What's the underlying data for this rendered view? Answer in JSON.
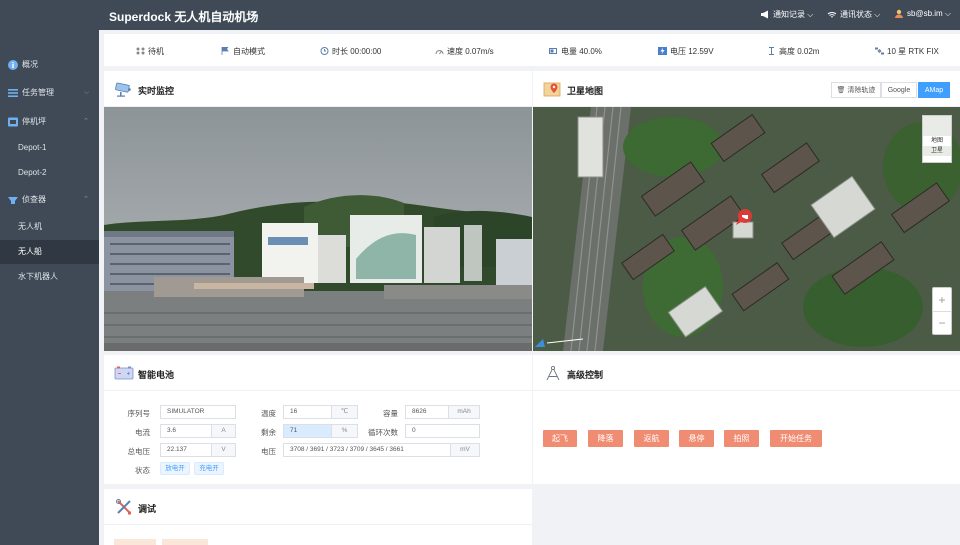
{
  "header": {
    "title": "Superdock 无人机自动机场",
    "notifications": "通知记录",
    "comm_status": "通讯状态",
    "user": "sb@sb.im"
  },
  "sidebar": {
    "overview": "概况",
    "task_mgmt": "任务管理",
    "dock": "停机坪",
    "depot1": "Depot-1",
    "depot2": "Depot-2",
    "scouts": "侦查器",
    "drone": "无人机",
    "boat": "无人船",
    "underwater": "水下机器人"
  },
  "status": {
    "state": "待机",
    "mode": "自动模式",
    "duration": "时长 00:00:00",
    "speed": "速度 0.07m/s",
    "battery": "电量 40.0%",
    "voltage": "电压 12.59V",
    "altitude": "高度 0.02m",
    "gps": "10 星 RTK FIX"
  },
  "panels": {
    "monitor": "实时监控",
    "satellite_map": "卫星地图",
    "battery": "智能电池",
    "advanced": "高级控制",
    "debug": "调试"
  },
  "map": {
    "clear_track": "清除轨迹",
    "google": "Google",
    "amap": "AMap",
    "layer_map": "地图",
    "layer_sat": "卫星"
  },
  "battery": {
    "serial_label": "序列号",
    "serial": "SIMULATOR",
    "current_label": "电流",
    "current": "3.6",
    "current_unit": "A",
    "total_voltage_label": "总电压",
    "total_voltage": "22.137",
    "total_voltage_unit": "V",
    "state_label": "状态",
    "discharge_switch": "放电开",
    "charge_switch": "充电开",
    "temp_label": "温度",
    "temp": "16",
    "temp_unit": "℃",
    "remaining_label": "剩余",
    "remaining": "71",
    "remaining_unit": "%",
    "cell_voltage_label": "电压",
    "cell_voltage": "3708 / 3691 / 3723 / 3709 / 3645 / 3661",
    "cell_voltage_unit": "mV",
    "capacity_label": "容量",
    "capacity": "8626",
    "capacity_unit": "mAh",
    "cycles_label": "循环次数",
    "cycles": "0"
  },
  "controls": {
    "takeoff": "起飞",
    "land": "降落",
    "return": "返航",
    "hover": "悬停",
    "photo": "拍照",
    "start_task": "开始任务"
  },
  "colors": {
    "sidebar_bg": "#3f4a56",
    "accent": "#409eff",
    "control_button": "#f08c72"
  }
}
